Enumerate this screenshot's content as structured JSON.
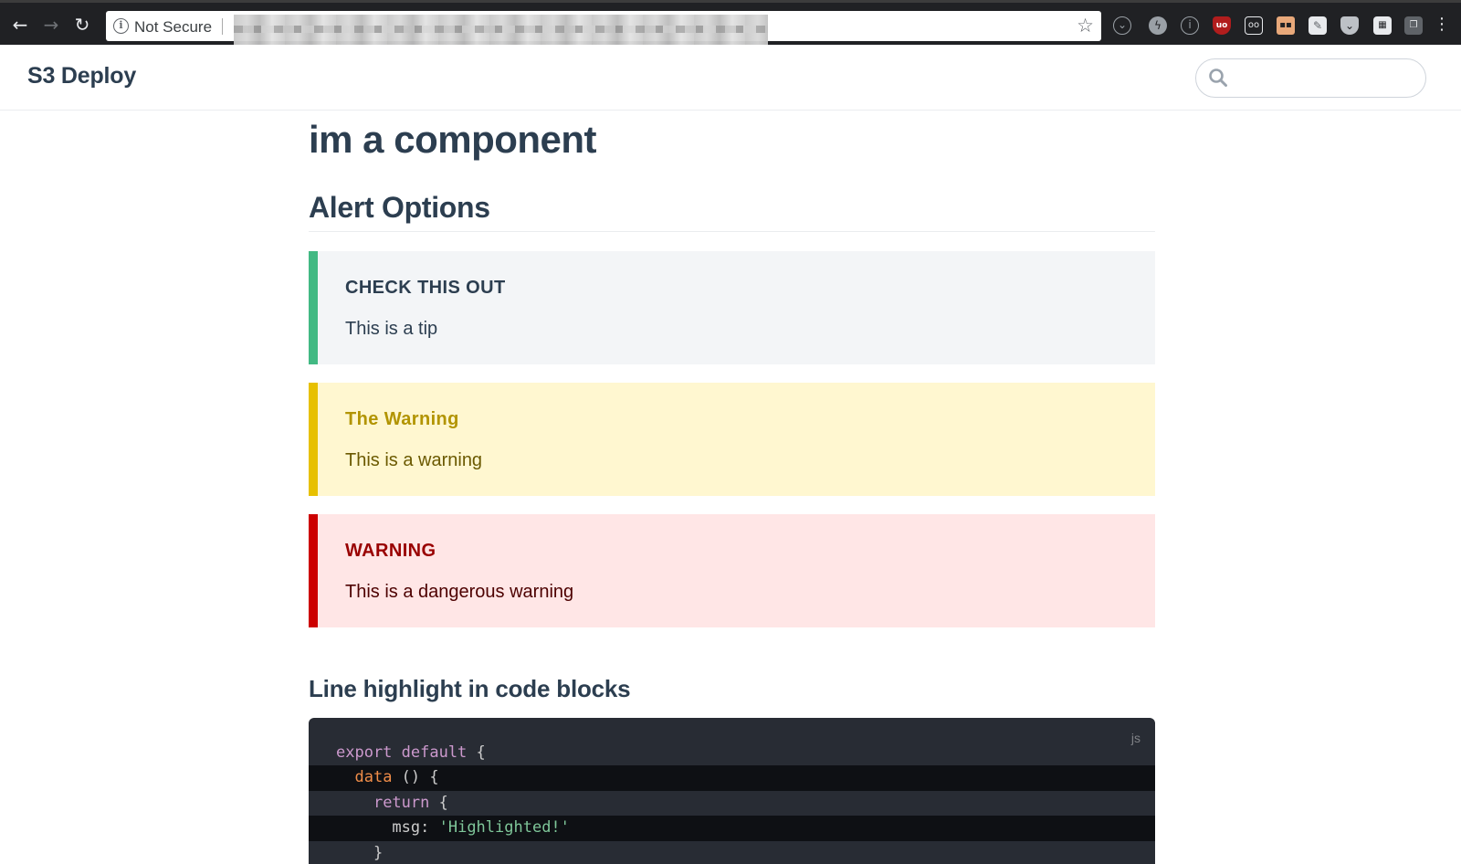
{
  "browser": {
    "security_label": "Not Secure",
    "info_glyph": "i",
    "back_glyph": "←",
    "forward_glyph": "→",
    "reload_glyph": "↻",
    "star_glyph": "☆",
    "menu_glyph": "⋮",
    "extensions": [
      "circle-outline-icon",
      "lightning-icon",
      "info-icon",
      "ublock-icon",
      "glasses-icon",
      "face-icon",
      "pin-icon",
      "pocket-icon",
      "puzzle-icon",
      "tabs-icon"
    ]
  },
  "header": {
    "brand": "S3 Deploy",
    "search_placeholder": ""
  },
  "page": {
    "title": "im a component",
    "section_title": "Alert Options",
    "alerts": [
      {
        "type": "tip",
        "title": "CHECK THIS OUT",
        "body": "This is a tip",
        "accent": "#42b983"
      },
      {
        "type": "warning",
        "title": "The Warning",
        "body": "This is a warning",
        "accent": "#e7c000"
      },
      {
        "type": "danger",
        "title": "WARNING",
        "body": "This is a dangerous warning",
        "accent": "#cc0000"
      }
    ],
    "code_section_title": "Line highlight in code blocks",
    "code": {
      "language": "js",
      "lines": [
        {
          "indent": "",
          "tokens": [
            "export default",
            " {"
          ],
          "highlighted": false
        },
        {
          "indent": "  ",
          "tokens": [
            "data",
            " () {"
          ],
          "highlighted": true
        },
        {
          "indent": "    ",
          "tokens": [
            "return",
            " {"
          ],
          "highlighted": false
        },
        {
          "indent": "      ",
          "tokens": [
            "msg: ",
            "'Highlighted!'"
          ],
          "highlighted": true
        },
        {
          "indent": "    ",
          "tokens": [
            "}"
          ],
          "highlighted": false
        }
      ]
    }
  }
}
